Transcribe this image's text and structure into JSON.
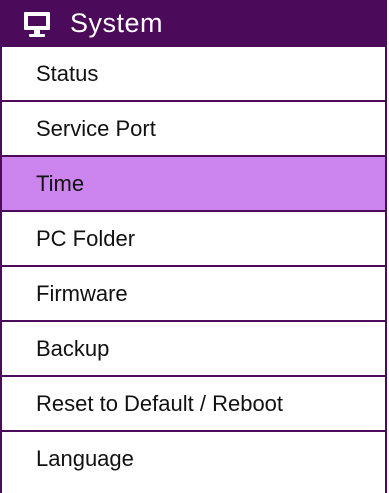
{
  "header": {
    "title": "System",
    "icon": "monitor-icon"
  },
  "colors": {
    "header_bg": "#4b0a5a",
    "border": "#4b0a5a",
    "selected_bg": "#cc85ee"
  },
  "menu": {
    "selected_label": "Time",
    "items": [
      {
        "label": "Status"
      },
      {
        "label": "Service Port"
      },
      {
        "label": "Time"
      },
      {
        "label": "PC Folder"
      },
      {
        "label": "Firmware"
      },
      {
        "label": "Backup"
      },
      {
        "label": "Reset to Default / Reboot"
      },
      {
        "label": "Language"
      }
    ]
  }
}
